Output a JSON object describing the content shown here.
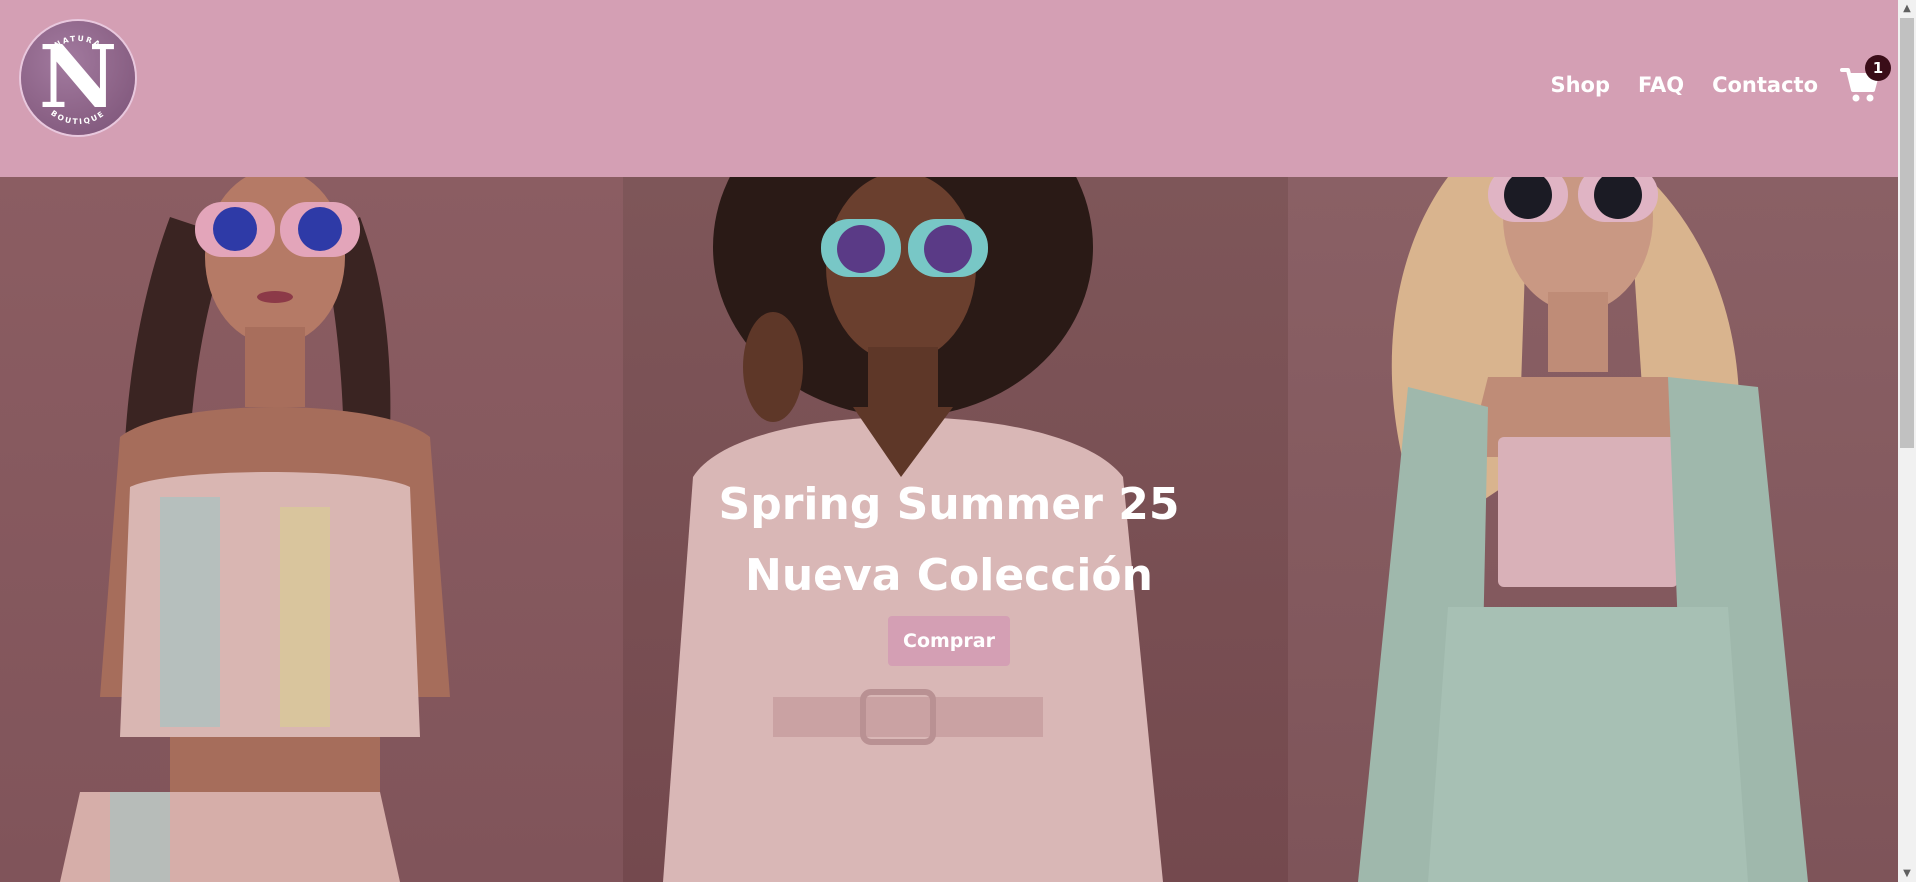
{
  "brand": {
    "logo_letter": "N",
    "logo_top_text": "NATURA",
    "logo_bottom_text": "BOUTIQUE"
  },
  "nav": {
    "items": [
      {
        "label": "Shop"
      },
      {
        "label": "FAQ"
      },
      {
        "label": "Contacto"
      }
    ]
  },
  "cart": {
    "icon": "shopping-cart-icon",
    "count": "1"
  },
  "hero": {
    "title_line1": "Spring Summer 25",
    "title_line2": "Nueva Colección",
    "cta_label": "Comprar",
    "images": [
      "model-pastel-top",
      "model-pink-jumpsuit",
      "model-mint-suit"
    ]
  },
  "colors": {
    "header_bg": "#d49fb4",
    "badge_bg": "#3a0d18",
    "cta_bg": "#d49fb4",
    "text": "#ffffff"
  }
}
